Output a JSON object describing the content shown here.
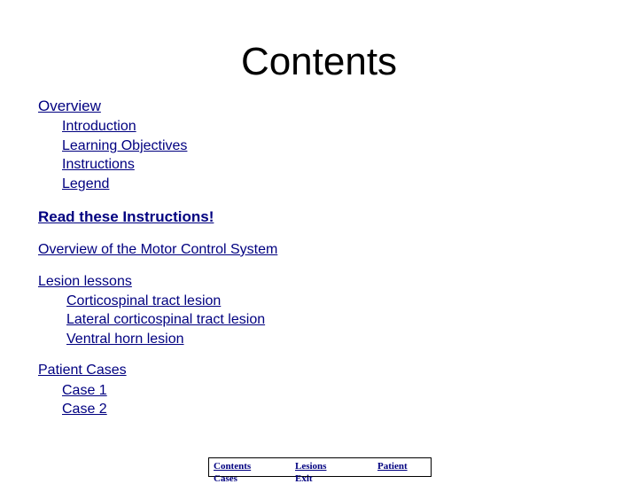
{
  "page": {
    "title": "Contents"
  },
  "toc": {
    "overview": {
      "label": "Overview",
      "items": [
        {
          "label": "Introduction"
        },
        {
          "label": "Learning Objectives"
        },
        {
          "label": "Instructions"
        },
        {
          "label": "Legend"
        }
      ]
    },
    "read_instructions": {
      "label": "Read these Instructions!"
    },
    "motor_overview": {
      "label": "Overview of the Motor Control System"
    },
    "lesions": {
      "label": "Lesion lessons",
      "items": [
        {
          "label": "Corticospinal tract lesion"
        },
        {
          "label": "Lateral corticospinal tract lesion"
        },
        {
          "label": "Ventral horn lesion"
        }
      ]
    },
    "patients": {
      "label": "Patient Cases",
      "items": [
        {
          "label": "Case 1"
        },
        {
          "label": "Case 2"
        }
      ]
    }
  },
  "navbar": {
    "items": [
      {
        "label": "Contents"
      },
      {
        "label": "Lesions"
      },
      {
        "label": "Patient"
      }
    ],
    "overflow": [
      {
        "label": "Cases"
      },
      {
        "label": "Exit"
      }
    ]
  },
  "colors": {
    "link": "#000080",
    "title": "#000000",
    "background": "#ffffff"
  }
}
